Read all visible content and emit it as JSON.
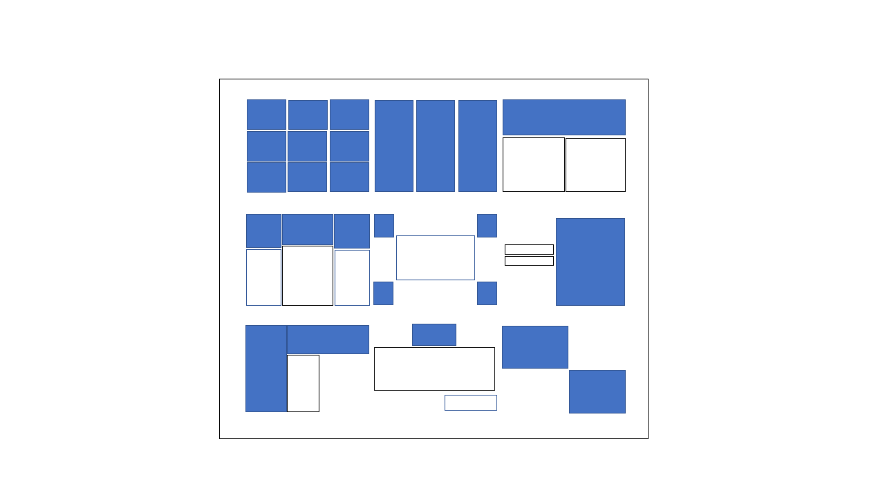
{
  "slide": {
    "background": "#FFFFFF",
    "frame_border_color": "#000000"
  },
  "colors": {
    "shape_fill": "#4472C4",
    "shape_outline": "#2F528F",
    "empty_outline_black": "#000000",
    "empty_outline_blue": "#2F5597"
  },
  "layouts": [
    "grid-3x3",
    "three-columns",
    "header-two-panels",
    "three-headers-three-panels",
    "four-corners-center-box",
    "two-bars-and-panel",
    "sidebar-header-panel",
    "header-box-footer",
    "diagonal-two-blocks"
  ]
}
